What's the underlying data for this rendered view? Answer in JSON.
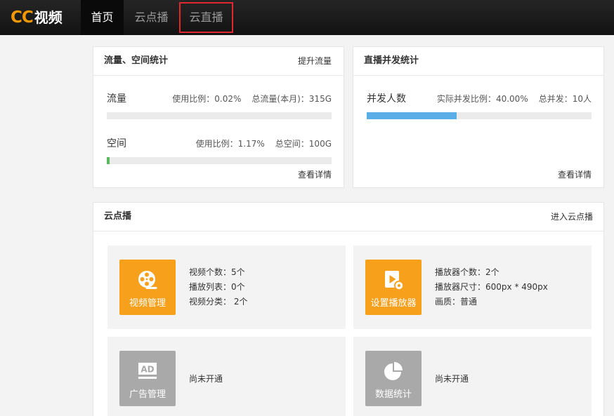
{
  "colors": {
    "logo_accent": "#f39800",
    "nav_highlight_border": "#e0282e",
    "usage_fill": "#5cb85c",
    "concurrency_fill": "#5aade6",
    "feature_active": "#f7a01c",
    "feature_inactive": "#a9a9a9"
  },
  "header": {
    "logo_mark": "CC",
    "logo_text": "视频",
    "nav": [
      {
        "label": "首页",
        "active": true,
        "highlighted": false
      },
      {
        "label": "云点播",
        "active": false,
        "highlighted": false
      },
      {
        "label": "云直播",
        "active": false,
        "highlighted": true
      }
    ]
  },
  "traffic_card": {
    "title": "流量、空间统计",
    "action": "提升流量",
    "rows": [
      {
        "label": "流量",
        "ratio_label": "使用比例：",
        "ratio": "0.02%",
        "total_label": "总流量(本月)：",
        "total": "315G",
        "fill_percent": 0.02
      },
      {
        "label": "空间",
        "ratio_label": "使用比例：",
        "ratio": "1.17%",
        "total_label": "总空间：",
        "total": "100G",
        "fill_percent": 1.17
      }
    ],
    "details": "查看详情"
  },
  "live_card": {
    "title": "直播并发统计",
    "rows": [
      {
        "label": "并发人数",
        "ratio_label": "实际并发比例：",
        "ratio": "40.00%",
        "total_label": "总并发：",
        "total": "10人",
        "fill_percent": 40
      }
    ],
    "details": "查看详情"
  },
  "vod_card": {
    "title": "云点播",
    "action": "进入云点播",
    "tiles": [
      {
        "name": "视频管理",
        "icon": "film-reel-icon",
        "enabled": true,
        "lines": [
          "视频个数：5个",
          "播放列表：0个",
          "视频分类： 2个"
        ]
      },
      {
        "name": "设置播放器",
        "icon": "player-settings-icon",
        "enabled": true,
        "lines": [
          "播放器个数：2个",
          "播放器尺寸：600px * 490px",
          "画质：普通"
        ]
      },
      {
        "name": "广告管理",
        "icon": "ad-icon",
        "icon_text": "AD",
        "enabled": false,
        "status": "尚未开通"
      },
      {
        "name": "数据统计",
        "icon": "pie-chart-icon",
        "enabled": false,
        "status": "尚未开通"
      }
    ]
  }
}
